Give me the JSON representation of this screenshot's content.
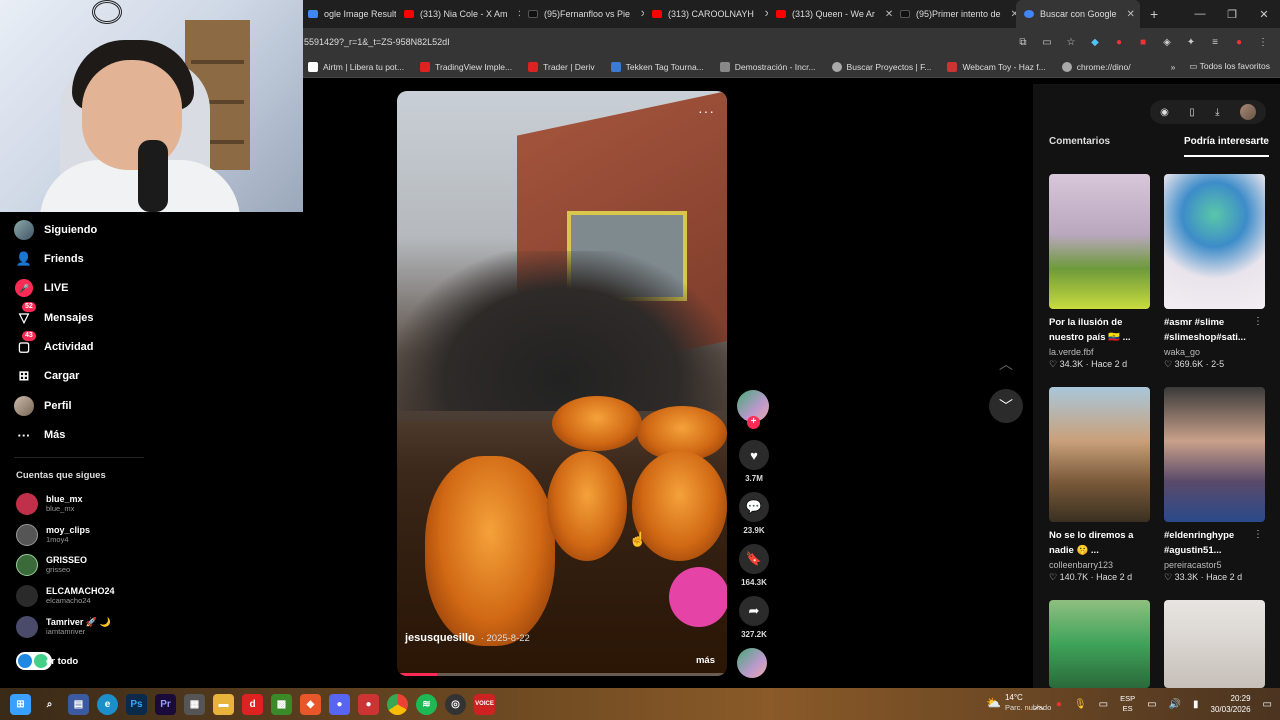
{
  "browser": {
    "tabs": [
      {
        "label": "ogle Image Result",
        "color": "#4285f4"
      },
      {
        "label": "(313) Nia Cole - X Am",
        "color": "#ff0000"
      },
      {
        "label": "(95)Fernanfloo vs Pie",
        "color": "#111111"
      },
      {
        "label": "(313) CAROOLNAYH",
        "color": "#ff0000"
      },
      {
        "label": "(313) Queen - We Ar",
        "color": "#ff0000"
      },
      {
        "label": "(95)Primer intento de",
        "color": "#111111"
      },
      {
        "label": "Buscar con Google",
        "color": "#4285f4"
      }
    ],
    "url": "5591429?_r=1&_t=ZS-958N82L52dI",
    "bookmarks": [
      {
        "label": "Airtm | Libera tu pot...",
        "color": "#ffffff"
      },
      {
        "label": "TradingView Imple...",
        "color": "#d22"
      },
      {
        "label": "Trader | Deriv",
        "color": "#d22"
      },
      {
        "label": "Tekken Tag Tourna...",
        "color": "#3b7bd6"
      },
      {
        "label": "Demostración - Incr...",
        "color": "#888"
      },
      {
        "label": "Buscar Proyectos | F...",
        "color": "#aaa"
      },
      {
        "label": "Webcam Toy - Haz f...",
        "color": "#c33"
      },
      {
        "label": "chrome://dino/",
        "color": "#aaa"
      }
    ],
    "all_bookmarks": "Todos los favoritos"
  },
  "nav": {
    "items": [
      {
        "label": "Siguiendo",
        "icon": "following-avatar-icon"
      },
      {
        "label": "Friends",
        "icon": "friends-icon"
      },
      {
        "label": "LIVE",
        "icon": "live-icon"
      },
      {
        "label": "Mensajes",
        "icon": "messages-icon",
        "badge": "52"
      },
      {
        "label": "Actividad",
        "icon": "activity-icon",
        "badge": "43"
      },
      {
        "label": "Cargar",
        "icon": "upload-icon"
      },
      {
        "label": "Perfil",
        "icon": "profile-avatar-icon"
      },
      {
        "label": "Más",
        "icon": "more-icon"
      }
    ],
    "following_title": "Cuentas que sigues",
    "accounts": [
      {
        "name": "blue_mx",
        "handle": "blue_mx",
        "color": "#c0304a"
      },
      {
        "name": "moy_clips",
        "handle": "1moy4",
        "color": "#555"
      },
      {
        "name": "GRISSEO",
        "handle": "grisseo",
        "color": "#3a6a3a"
      },
      {
        "name": "ELCAMACHO24",
        "handle": "elcamacho24",
        "color": "#2a2a2a"
      },
      {
        "name": "Tamriver 🚀 🌙",
        "handle": "iamtamriver",
        "color": "#4a4a6a"
      }
    ],
    "see_all": "er todo"
  },
  "video": {
    "author": "jesusquesillo",
    "date": "· 2025-8-22",
    "more": "más",
    "progress_fraction": 0.12
  },
  "actions": {
    "likes": "3.7M",
    "comments": "23.9K",
    "saves": "164.3K",
    "shares": "327.2K"
  },
  "panel": {
    "tabs": [
      "Comentarios",
      "Podría interesarte"
    ],
    "cards": [
      {
        "title": "Por la ilusión de nuestro país 🇪🇨 ...",
        "user": "la.verde.fbf",
        "meta": "♡ 34.3K · Hace 2 d",
        "bg": "linear-gradient(180deg,#d7c7d9 0%,#b9a7be 45%,#6d9a3a 70%,#c9db3f 100%)"
      },
      {
        "title": "#asmr #slime #slimeshop#sati...",
        "user": "waka_go",
        "meta": "♡ 369.6K · 2-5",
        "bg": "radial-gradient(circle at 50% 30%,#5ac7a9 0%,#3d8cc9 30%,#e9e4ec 60%,#f3eef3 100%)"
      },
      {
        "title": "No se lo diremos a nadie 🤫 ...",
        "user": "colleenbarry123",
        "meta": "♡ 140.7K · Hace 2 d",
        "bg": "linear-gradient(180deg,#a9c7da 0%,#c9a07a 40%,#7a5a3a 70%,#3a3020 100%)"
      },
      {
        "title": "#eldenringhype #agustin51...",
        "user": "pereiracastor5",
        "meta": "♡ 33.3K · Hace 2 d",
        "bg": "linear-gradient(180deg,#3a3a3a 0%,#c9a08a 40%,#5a4a6a 70%,#2a4a8a 100%)"
      },
      {
        "title": "",
        "user": "",
        "meta": "",
        "bg": "linear-gradient(180deg,#8fbf7f 0%,#3fa35a 50%,#2a6a3a 100%)"
      },
      {
        "title": "",
        "user": "",
        "meta": "",
        "bg": "linear-gradient(180deg,#e8e5e2 0%,#d9d4cf 50%,#c7c0b9 100%)"
      }
    ]
  },
  "taskbar": {
    "weather_temp": "14°C",
    "weather_desc": "Parc. nublado",
    "lang1": "ESP",
    "lang2": "ES",
    "time": "20:29",
    "date": "30/03/2026"
  }
}
